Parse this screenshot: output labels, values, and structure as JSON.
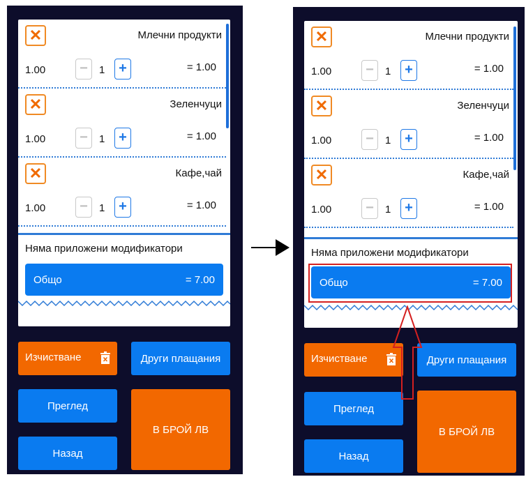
{
  "left": {
    "items": [
      {
        "name": "Млечни продукти",
        "price": "1.00",
        "qty": "1",
        "total": "= 1.00"
      },
      {
        "name": "Зеленчуци",
        "price": "1.00",
        "qty": "1",
        "total": "= 1.00"
      },
      {
        "name": "Кафе,чай",
        "price": "1.00",
        "qty": "1",
        "total": "= 1.00"
      }
    ],
    "modifiers_text": "Няма приложени модификатори",
    "total_label": "Общо",
    "total_value": "= 7.00",
    "buttons": {
      "clear": "Изчистване",
      "other_payments": "Други плащания",
      "review": "Преглед",
      "cash": "В БРОЙ ЛВ",
      "back": "Назад"
    }
  },
  "right": {
    "items": [
      {
        "name": "Млечни продукти",
        "price": "1.00",
        "qty": "1",
        "total": "= 1.00"
      },
      {
        "name": "Зеленчуци",
        "price": "1.00",
        "qty": "1",
        "total": "= 1.00"
      },
      {
        "name": "Кафе,чай",
        "price": "1.00",
        "qty": "1",
        "total": "= 1.00"
      }
    ],
    "modifiers_text": "Няма приложени модификатори",
    "total_label": "Общо",
    "total_value": "= 7.00",
    "buttons": {
      "clear": "Изчистване",
      "other_payments": "Други плащания",
      "review": "Преглед",
      "cash": "В БРОЙ ЛВ",
      "back": "Назад"
    }
  },
  "icons": {
    "remove": "close-icon",
    "decrease": "minus-icon",
    "increase": "plus-icon",
    "trash": "trash-icon"
  },
  "colors": {
    "background": "#0d0d2b",
    "accent_blue": "#0a7bf0",
    "accent_orange": "#f26800",
    "highlight_red": "#d42020"
  },
  "glyphs": {
    "close": "✕",
    "minus": "−",
    "plus": "+"
  }
}
